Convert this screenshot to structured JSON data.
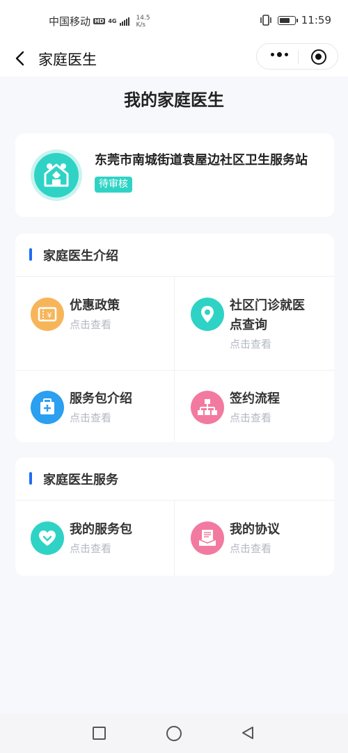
{
  "status_bar": {
    "carrier": "中国移动",
    "hd": "HD",
    "net": "4G",
    "speed_value": "14.5",
    "speed_unit": "K/s",
    "time": "11:59"
  },
  "nav": {
    "title": "家庭医生"
  },
  "page": {
    "title": "我的家庭医生"
  },
  "station": {
    "name": "东莞市南城街道袁屋边社区卫生服务站",
    "status": "待审核"
  },
  "intro": {
    "title": "家庭医生介绍",
    "items": [
      {
        "title": "优惠政策",
        "sub": "点击查看",
        "icon": "coupon-icon",
        "color": "#f7b55a"
      },
      {
        "title_line1": "社区门诊就医",
        "title_line2": "点查询",
        "sub": "点击查看",
        "icon": "location-pin-icon",
        "color": "#2fd3c5"
      },
      {
        "title": "服务包介绍",
        "sub": "点击查看",
        "icon": "medical-kit-icon",
        "color": "#2b9ff0"
      },
      {
        "title": "签约流程",
        "sub": "点击查看",
        "icon": "flowchart-icon",
        "color": "#f27aa0"
      }
    ]
  },
  "service": {
    "title": "家庭医生服务",
    "items": [
      {
        "title": "我的服务包",
        "sub": "点击查看",
        "icon": "heart-package-icon",
        "color": "#2fd3c5"
      },
      {
        "title": "我的协议",
        "sub": "点击查看",
        "icon": "agreement-icon",
        "color": "#f27aa0"
      }
    ]
  }
}
